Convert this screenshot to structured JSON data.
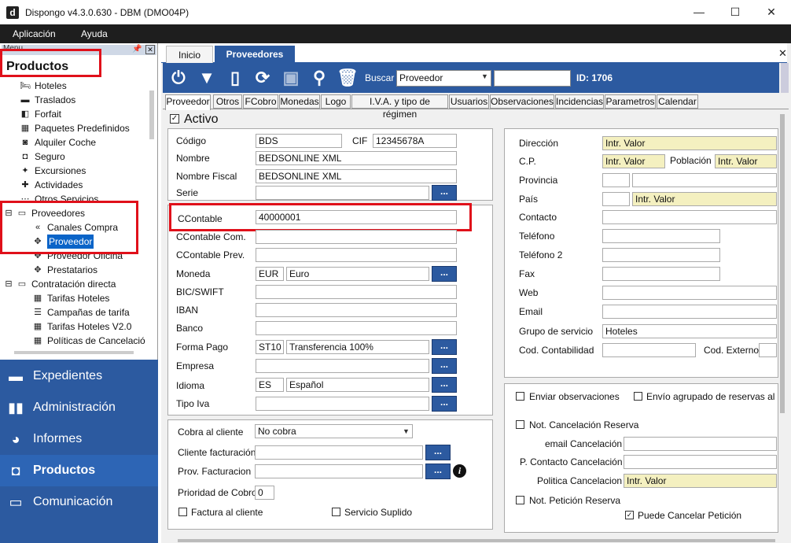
{
  "window": {
    "title": "Dispongo v4.3.0.630 - DBM (DMO04P)",
    "logo_letter": "d",
    "minimize": "—",
    "maximize": "☐",
    "close": "✕"
  },
  "menubar": {
    "items": [
      "Aplicación",
      "Ayuda"
    ]
  },
  "left_panel": {
    "header": "Menu",
    "section_title": "Productos",
    "tree": [
      {
        "label": "Hoteles",
        "icon": "bed-icon"
      },
      {
        "label": "Traslados",
        "icon": "bus-icon"
      },
      {
        "label": "Forfait",
        "icon": "ticket-icon"
      },
      {
        "label": "Paquetes Predefinidos",
        "icon": "package-icon"
      },
      {
        "label": "Alquiler Coche",
        "icon": "car-icon"
      },
      {
        "label": "Seguro",
        "icon": "shield-icon"
      },
      {
        "label": "Excursiones",
        "icon": "excursion-icon"
      },
      {
        "label": "Actividades",
        "icon": "activity-icon"
      },
      {
        "label": "Otros Servicios",
        "icon": "services-icon"
      },
      {
        "label": "Proveedores",
        "icon": "folder-icon",
        "expander": "⊟"
      },
      {
        "label": "Canales Compra",
        "icon": "channels-icon"
      },
      {
        "label": "Proveedor",
        "icon": "puzzle-icon"
      },
      {
        "label": "Proveedor Oficina",
        "icon": "puzzle-icon"
      },
      {
        "label": "Prestatarios",
        "icon": "puzzle-icon"
      },
      {
        "label": "Contratación directa",
        "icon": "folder-icon",
        "expander": "⊟"
      },
      {
        "label": "Tarifas Hoteles",
        "icon": "calendar-icon"
      },
      {
        "label": "Campañas de tarifa",
        "icon": "list-icon"
      },
      {
        "label": "Tarifas Hoteles V2.0",
        "icon": "calendar-icon"
      },
      {
        "label": "Políticas de Cancelació",
        "icon": "calendar-icon"
      }
    ],
    "nav": [
      {
        "label": "Expedientes",
        "icon": "folder-icon"
      },
      {
        "label": "Administración",
        "icon": "bar-chart-icon"
      },
      {
        "label": "Informes",
        "icon": "pie-chart-icon"
      },
      {
        "label": "Productos",
        "icon": "suitcase-icon"
      },
      {
        "label": "Comunicación",
        "icon": "monitor-icon"
      }
    ]
  },
  "doc_tabs": {
    "inicio": "Inicio",
    "proveedores": "Proveedores",
    "close": "✕"
  },
  "toolbar": {
    "search_label": "Buscar",
    "search_select": "Proveedor",
    "search_value": "",
    "id_label": "ID: 1706"
  },
  "subtabs": [
    "Proveedor",
    "Otros",
    "FCobro",
    "Monedas",
    "Logo",
    "I.V.A. y tipo de régimen",
    "Usuarios",
    "Observaciones",
    "Incidencias",
    "Parametros",
    "Calendar"
  ],
  "form": {
    "activo_label": "Activo",
    "activo_checked": "✓",
    "codigo_label": "Código",
    "codigo_value": "BDS",
    "cif_label": "CIF",
    "cif_value": "12345678A",
    "nombre_label": "Nombre",
    "nombre_value": "BEDSONLINE XML",
    "nombre_fiscal_label": "Nombre Fiscal",
    "nombre_fiscal_value": "BEDSONLINE XML",
    "serie_label": "Serie",
    "serie_value": "",
    "ccontable_label": "CContable",
    "ccontable_value": "40000001",
    "ccontable_com_label": "CContable Com.",
    "ccontable_prev_label": "CContable Prev.",
    "moneda_label": "Moneda",
    "moneda_code": "EUR",
    "moneda_name": "Euro",
    "bic_label": "BIC/SWIFT",
    "iban_label": "IBAN",
    "banco_label": "Banco",
    "forma_pago_label": "Forma Pago",
    "forma_pago_code": "ST10",
    "forma_pago_name": "Transferencia 100%",
    "empresa_label": "Empresa",
    "idioma_label": "Idioma",
    "idioma_code": "ES",
    "idioma_name": "Español",
    "tipo_iva_label": "Tipo Iva",
    "dots": "...",
    "cobra_label": "Cobra al cliente",
    "cobra_value": "No cobra",
    "cliente_fact_label": "Cliente facturación",
    "prov_fact_label": "Prov. Facturacion",
    "prioridad_label": "Prioridad de Cobro",
    "prioridad_value": "0",
    "factura_cliente_label": "Factura al cliente",
    "servicio_suplido_label": "Servicio Suplido",
    "info": "i",
    "direccion_label": "Dirección",
    "intr_valor": "Intr. Valor",
    "cp_label": "C.P.",
    "poblacion_label": "Población",
    "provincia_label": "Provincia",
    "pais_label": "País",
    "contacto_label": "Contacto",
    "telefono_label": "Teléfono",
    "telefono2_label": "Teléfono 2",
    "fax_label": "Fax",
    "web_label": "Web",
    "email_label": "Email",
    "grupo_servicio_label": "Grupo de servicio",
    "grupo_servicio_value": "Hoteles",
    "cod_contabilidad_label": "Cod. Contabilidad",
    "cod_externo_label": "Cod. Externo",
    "enviar_obs_label": "Enviar observaciones",
    "envio_agrupado_label": "Envío agrupado de reservas al fina",
    "not_cancel_label": "Not. Cancelación Reserva",
    "email_cancel_label": "email Cancelación",
    "p_contacto_cancel_label": "P. Contacto Cancelación",
    "politica_cancel_label": "Politica Cancelacion",
    "not_peticion_label": "Not. Petición Reserva",
    "puede_cancelar_label": "Puede Cancelar Petición"
  }
}
